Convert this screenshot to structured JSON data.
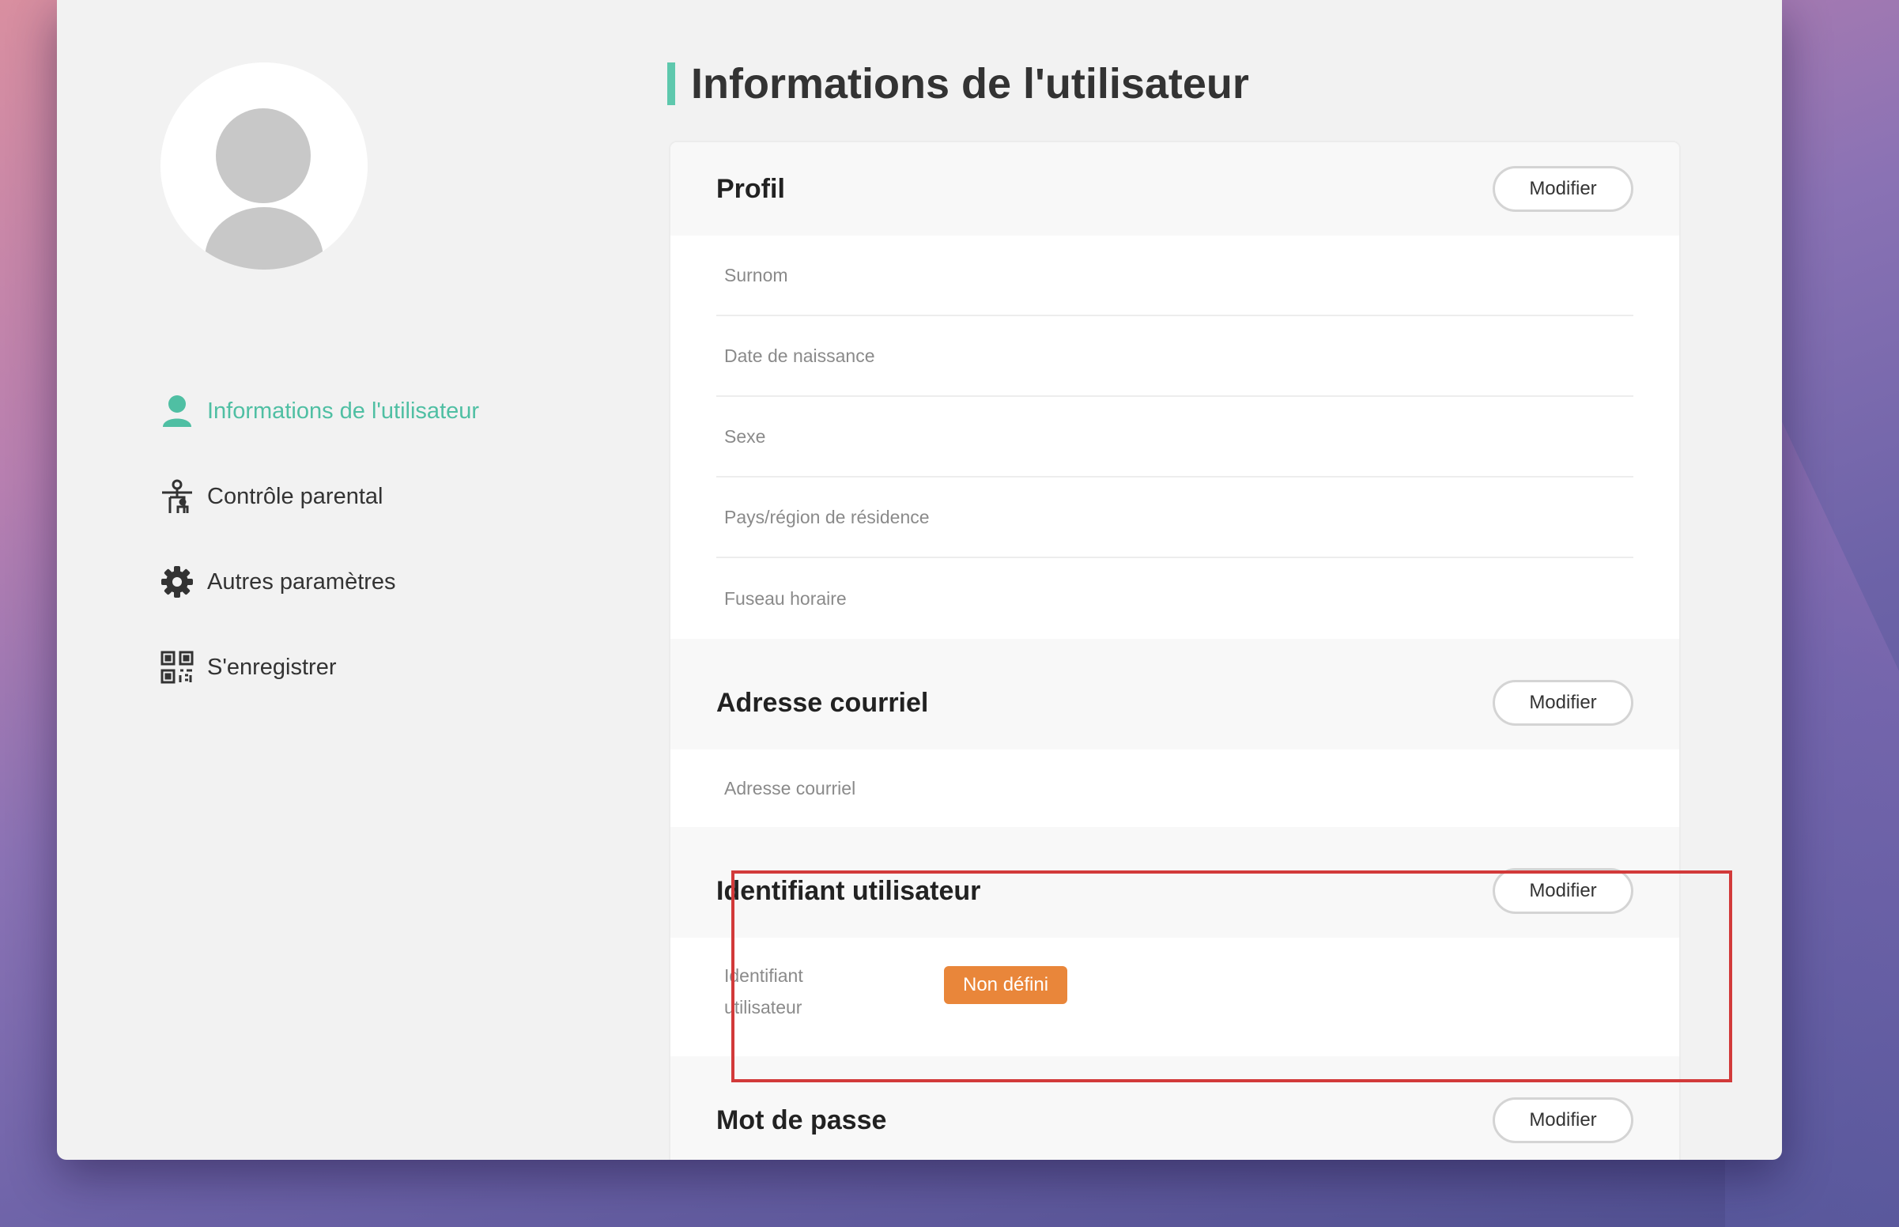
{
  "page_title": "Informations de l'utilisateur",
  "sidebar": {
    "items": [
      {
        "label": "Informations de l'utilisateur",
        "icon": "user-icon",
        "active": true
      },
      {
        "label": "Contrôle parental",
        "icon": "parental-control-icon",
        "active": false
      },
      {
        "label": "Autres paramètres",
        "icon": "gear-icon",
        "active": false
      },
      {
        "label": "S'enregistrer",
        "icon": "qr-code-icon",
        "active": false
      }
    ]
  },
  "sections": {
    "profile": {
      "title": "Profil",
      "button": "Modifier",
      "fields": [
        "Surnom",
        "Date de naissance",
        "Sexe",
        "Pays/région de résidence",
        "Fuseau horaire"
      ]
    },
    "email": {
      "title": "Adresse courriel",
      "button": "Modifier",
      "field": "Adresse courriel"
    },
    "user_id": {
      "title": "Identifiant utilisateur",
      "button": "Modifier",
      "label_line1": "Identifiant",
      "label_line2": "utilisateur",
      "status": "Non défini"
    },
    "password": {
      "title": "Mot de passe",
      "button": "Modifier"
    }
  },
  "colors": {
    "accent": "#4fbfa3",
    "badge": "#e9863a",
    "highlight": "#d23a3a"
  }
}
